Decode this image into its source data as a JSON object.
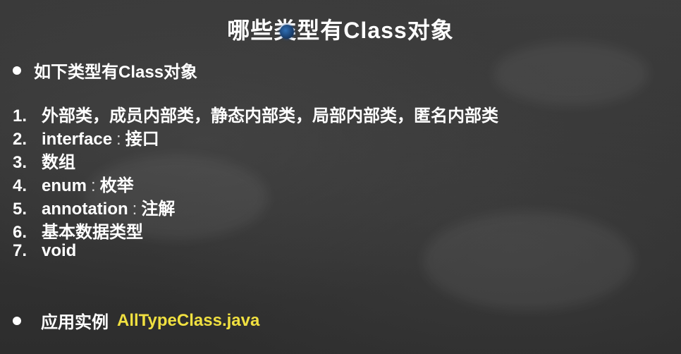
{
  "slide": {
    "title": "哪些类型有Class对象",
    "intro": "如下类型有Class对象",
    "items": [
      {
        "num": "1.",
        "term": "外部类，成员内部类，静态内部类，局部内部类，匿名内部类",
        "sep": "",
        "desc": ""
      },
      {
        "num": "2.",
        "term": "interface",
        "sep": ":",
        "desc": "接口"
      },
      {
        "num": "3.",
        "term": "数组",
        "sep": "",
        "desc": ""
      },
      {
        "num": "4.",
        "term": "enum",
        "sep": ":",
        "desc": "枚举"
      },
      {
        "num": "5.",
        "term": "annotation",
        "sep": ":",
        "desc": "注解"
      },
      {
        "num": "6.",
        "term": "基本数据类型",
        "sep": "",
        "desc": ""
      },
      {
        "num": "7.",
        "term": "void",
        "sep": "",
        "desc": ""
      }
    ],
    "example_label": "应用实例",
    "example_file": "AllTypeClass.java"
  },
  "colors": {
    "background": "#333333",
    "text": "#ffffff",
    "highlight": "#f0e040",
    "cursor": "#2f6fb5"
  }
}
